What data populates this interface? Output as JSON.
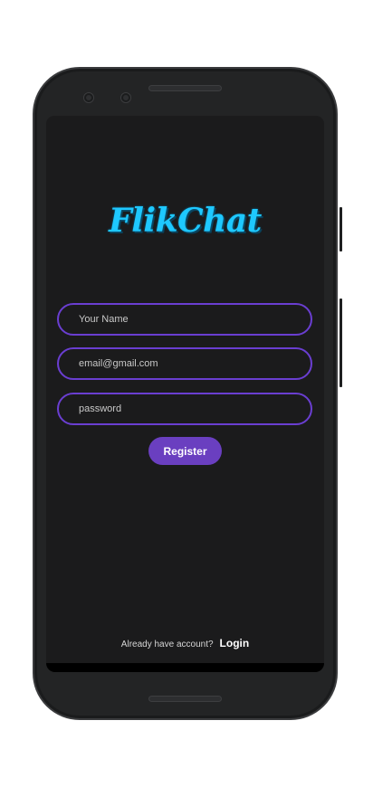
{
  "app": {
    "logo_text": "FlikChat",
    "accent_color": "#6a3fc0",
    "logo_color": "#1ec8ff"
  },
  "form": {
    "name_placeholder": "Your Name",
    "email_placeholder": "email@gmail.com",
    "password_placeholder": "password",
    "register_label": "Register"
  },
  "footer": {
    "account_text": "Already have account?",
    "login_label": "Login"
  }
}
